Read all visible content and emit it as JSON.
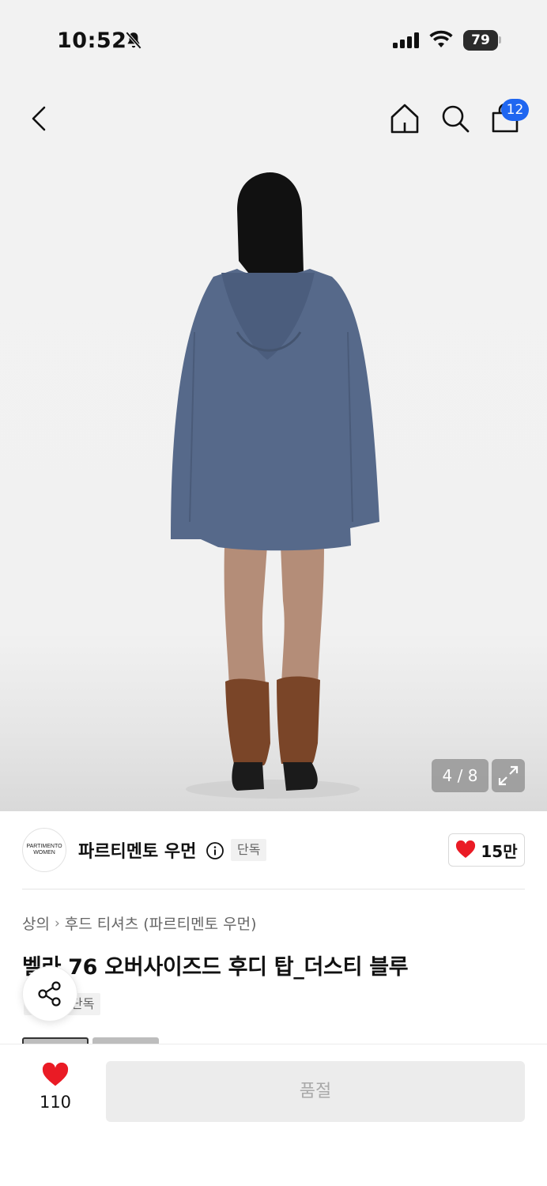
{
  "status_bar": {
    "time": "10:52",
    "battery": "79"
  },
  "header": {
    "cart_count": "12"
  },
  "gallery": {
    "counter": "4 / 8"
  },
  "brand": {
    "logo_text": "PARTIMENTO\nWOMEN",
    "name": "파르티멘토 우먼",
    "exclusive_tag": "단독",
    "likes": "15만"
  },
  "product": {
    "breadcrumb": [
      "상의",
      "후드 티셔츠 (파르티멘토 우먼)"
    ],
    "title": "벨라 76 오버사이즈드 후디 탑_더스티 블루",
    "tag": "단독"
  },
  "bottom": {
    "wish_count": "110",
    "soldout_label": "품절"
  },
  "colors": {
    "accent_blue": "#1f66f0",
    "heart_red": "#ea1b25",
    "hoodie_blue": "#56698a",
    "boot_brown": "#7a4528"
  },
  "icons": [
    "bell-slash-icon",
    "signal-icon",
    "wifi-icon",
    "back-icon",
    "home-icon",
    "search-icon",
    "bag-icon",
    "expand-icon",
    "info-icon",
    "heart-icon",
    "share-icon"
  ]
}
